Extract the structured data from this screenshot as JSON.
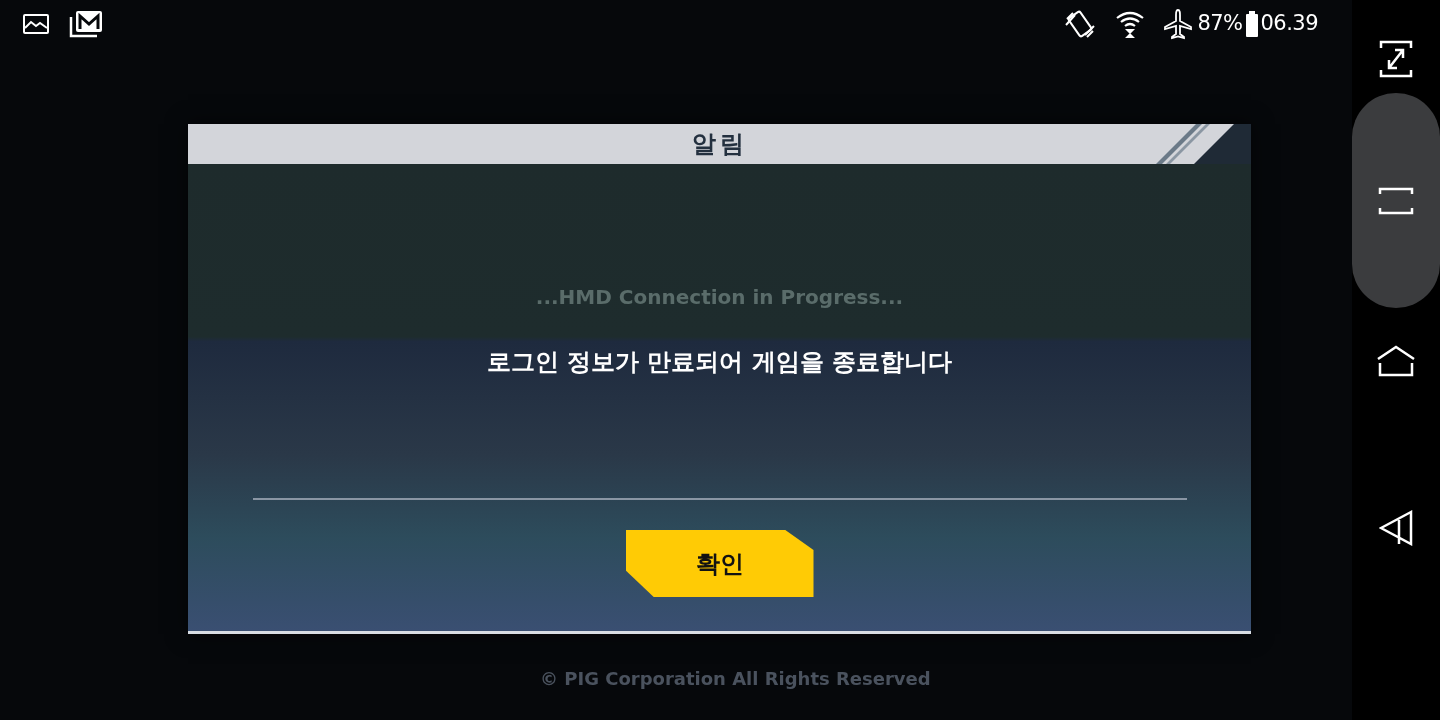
{
  "status_bar": {
    "battery": "87%",
    "time": "06.39"
  },
  "background": {
    "status_text": "...HMD Connection in Progress...",
    "copyright": "© PIG Corporation All Rights Reserved"
  },
  "dialog": {
    "title": "알림",
    "message": "로그인 정보가 만료되어 게임을 종료합니다",
    "buttons": [
      {
        "label": "확인"
      }
    ]
  }
}
